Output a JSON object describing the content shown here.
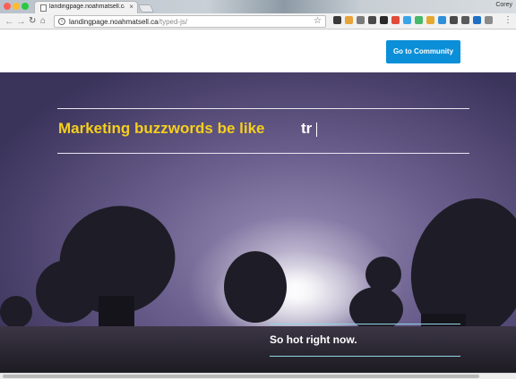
{
  "browser": {
    "tab_title": "landingpage.noahmatsell.ca/typed-js",
    "tab_close": "×",
    "user": "Corey",
    "url_host": "landingpage.noahmatsell.ca",
    "url_path": "/typed-js/",
    "icons": {
      "back": "back-arrow-icon",
      "forward": "forward-arrow-icon",
      "reload": "reload-icon",
      "home": "home-icon",
      "info": "info-icon",
      "star": "star-icon",
      "menu": "menu-icon"
    },
    "extension_colors": [
      "#3a3a3a",
      "#e8a23a",
      "#7a7a7a",
      "#4a4a4a",
      "#2a2a2a",
      "#e24a3a",
      "#3aa4e8",
      "#48b86a",
      "#e5a92f",
      "#2f8fd8",
      "#4a4a4a",
      "#5a5a5a",
      "#1f6fc5",
      "#8a8a8a"
    ]
  },
  "nav": {
    "community_button": "Go to Community",
    "button_color": "#0a8fd8"
  },
  "hero": {
    "headline": "Marketing buzzwords be like",
    "typed_text": "tr",
    "tagline": "So hot right now.",
    "headline_color": "#f7cf1d"
  }
}
